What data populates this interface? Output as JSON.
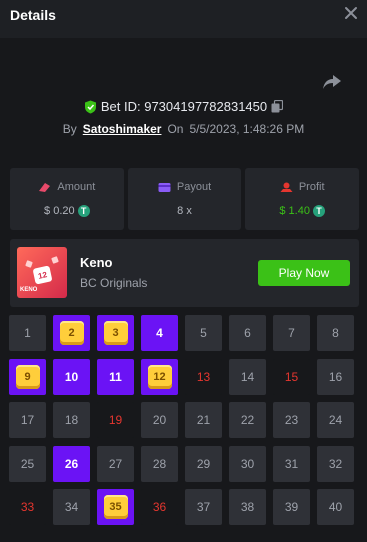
{
  "header": {
    "title": "Details"
  },
  "bet": {
    "id_label": "Bet ID: 97304197782831450",
    "by_label": "By",
    "user": "Satoshimaker",
    "on_label": "On",
    "datetime": "5/5/2023, 1:48:26 PM"
  },
  "stats": {
    "amount": {
      "label": "Amount",
      "value": "$ 0.20"
    },
    "payout": {
      "label": "Payout",
      "value": "8 x"
    },
    "profit": {
      "label": "Profit",
      "value": "$ 1.40"
    }
  },
  "game": {
    "name": "Keno",
    "provider": "BC Originals",
    "thumb_text": "KENO",
    "thumb_ball": "12",
    "play_label": "Play Now"
  },
  "keno": {
    "cells": [
      {
        "n": "1",
        "s": "normal"
      },
      {
        "n": "2",
        "s": "hit"
      },
      {
        "n": "3",
        "s": "hit"
      },
      {
        "n": "4",
        "s": "pick"
      },
      {
        "n": "5",
        "s": "normal"
      },
      {
        "n": "6",
        "s": "normal"
      },
      {
        "n": "7",
        "s": "normal"
      },
      {
        "n": "8",
        "s": "normal"
      },
      {
        "n": "9",
        "s": "hit"
      },
      {
        "n": "10",
        "s": "pick"
      },
      {
        "n": "11",
        "s": "pick"
      },
      {
        "n": "12",
        "s": "hit"
      },
      {
        "n": "13",
        "s": "miss"
      },
      {
        "n": "14",
        "s": "normal"
      },
      {
        "n": "15",
        "s": "miss"
      },
      {
        "n": "16",
        "s": "normal"
      },
      {
        "n": "17",
        "s": "normal"
      },
      {
        "n": "18",
        "s": "normal"
      },
      {
        "n": "19",
        "s": "miss"
      },
      {
        "n": "20",
        "s": "normal"
      },
      {
        "n": "21",
        "s": "normal"
      },
      {
        "n": "22",
        "s": "normal"
      },
      {
        "n": "23",
        "s": "normal"
      },
      {
        "n": "24",
        "s": "normal"
      },
      {
        "n": "25",
        "s": "normal"
      },
      {
        "n": "26",
        "s": "pick"
      },
      {
        "n": "27",
        "s": "normal"
      },
      {
        "n": "28",
        "s": "normal"
      },
      {
        "n": "29",
        "s": "normal"
      },
      {
        "n": "30",
        "s": "normal"
      },
      {
        "n": "31",
        "s": "normal"
      },
      {
        "n": "32",
        "s": "normal"
      },
      {
        "n": "33",
        "s": "miss"
      },
      {
        "n": "34",
        "s": "normal"
      },
      {
        "n": "35",
        "s": "hit"
      },
      {
        "n": "36",
        "s": "miss"
      },
      {
        "n": "37",
        "s": "normal"
      },
      {
        "n": "38",
        "s": "normal"
      },
      {
        "n": "39",
        "s": "normal"
      },
      {
        "n": "40",
        "s": "normal"
      }
    ]
  },
  "colors": {
    "accent_purple": "#6b13f5",
    "success_green": "#3bc117",
    "miss_red": "#e5362f",
    "gem_yellow": "#ffce3b"
  }
}
